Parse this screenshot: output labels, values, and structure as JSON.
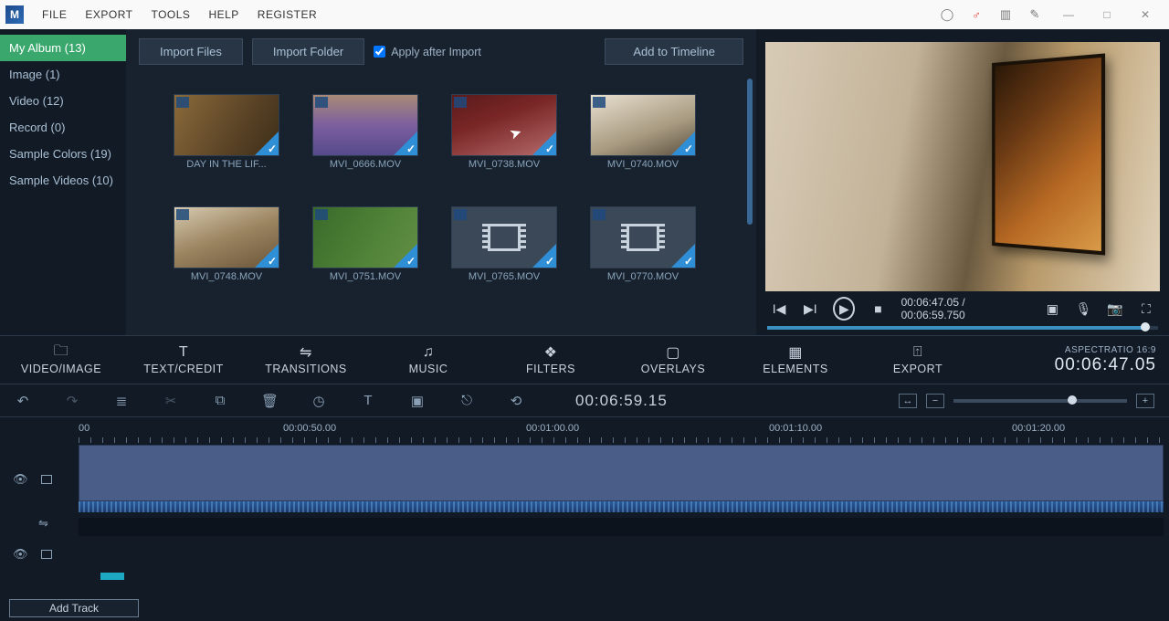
{
  "menu": {
    "items": [
      "FILE",
      "EXPORT",
      "TOOLS",
      "HELP",
      "REGISTER"
    ]
  },
  "sidebar": {
    "items": [
      {
        "label": "My Album (13)",
        "active": true
      },
      {
        "label": "Image (1)"
      },
      {
        "label": "Video (12)"
      },
      {
        "label": "Record (0)"
      },
      {
        "label": "Sample Colors (19)"
      },
      {
        "label": "Sample Videos (10)"
      }
    ]
  },
  "media_toolbar": {
    "import_files": "Import Files",
    "import_folder": "Import Folder",
    "apply_after": "Apply after Import",
    "add_timeline": "Add to Timeline"
  },
  "thumbs": [
    {
      "label": "DAY IN THE LIF...",
      "cls": "t1"
    },
    {
      "label": "MVI_0666.MOV",
      "cls": "t2"
    },
    {
      "label": "MVI_0738.MOV",
      "cls": "t3"
    },
    {
      "label": "MVI_0740.MOV",
      "cls": "t4"
    },
    {
      "label": "MVI_0748.MOV",
      "cls": "t5"
    },
    {
      "label": "MVI_0751.MOV",
      "cls": "t6"
    },
    {
      "label": "MVI_0765.MOV",
      "cls": "generic"
    },
    {
      "label": "MVI_0770.MOV",
      "cls": "generic"
    }
  ],
  "preview": {
    "current": "00:06:47.05",
    "total": "00:06:59.750"
  },
  "tabs": [
    {
      "label": "VIDEO/IMAGE",
      "icon": "folder-icon"
    },
    {
      "label": "TEXT/CREDIT",
      "icon": "text-icon"
    },
    {
      "label": "TRANSITIONS",
      "icon": "transitions-icon"
    },
    {
      "label": "MUSIC",
      "icon": "music-icon"
    },
    {
      "label": "FILTERS",
      "icon": "filters-icon"
    },
    {
      "label": "OVERLAYS",
      "icon": "overlays-icon"
    },
    {
      "label": "ELEMENTS",
      "icon": "elements-icon"
    },
    {
      "label": "EXPORT",
      "icon": "export-icon"
    }
  ],
  "aspect": {
    "label": "ASPECTRATIO 16:9",
    "time": "00:06:47.05"
  },
  "toolbar_time": "00:06:59.15",
  "ruler": [
    "00",
    "00:00:50.00",
    "00:01:00.00",
    "00:01:10.00",
    "00:01:20.00"
  ],
  "add_track": "Add Track"
}
